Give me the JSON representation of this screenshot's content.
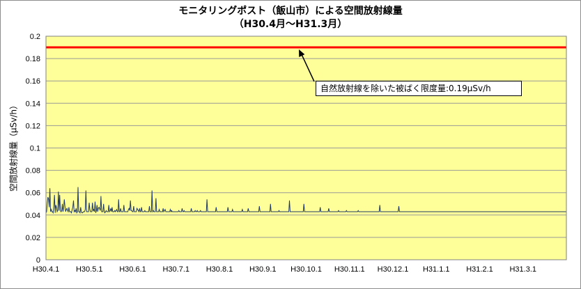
{
  "chart_data": {
    "type": "line",
    "title": "モニタリングポスト（飯山市）による空間放射線量",
    "subtitle": "（H30.4月～H31.3月）",
    "ylabel": "空間放射線量（μSv/h）",
    "xlabel": "",
    "ylim": [
      0,
      0.2
    ],
    "y_ticks": [
      "0",
      "0.02",
      "0.04",
      "0.06",
      "0.08",
      "0.1",
      "0.12",
      "0.14",
      "0.16",
      "0.18",
      "0.2"
    ],
    "x_ticks": [
      "H30.4.1",
      "H30.5.1",
      "H30.6.1",
      "H30.7.1",
      "H30.8.1",
      "H30.9.1",
      "H30.10.1",
      "H30.11.1",
      "H30.12.1",
      "H31.1.1",
      "H31.2.1",
      "H31.3.1"
    ],
    "grid": true,
    "reference_line": {
      "value": 0.19,
      "label": "自然放射線を除いた被ばく限度量:0.19μSv/h",
      "color": "#ff0000"
    },
    "series_color": "#1f3864",
    "plot_background": "#ffff99",
    "series": [
      {
        "values": [
          0.042,
          0.043,
          0.051,
          0.056,
          0.054,
          0.047,
          0.064,
          0.043,
          0.045,
          0.043,
          0.043,
          0.042,
          0.048,
          0.058,
          0.042,
          0.049,
          0.047,
          0.043,
          0.044,
          0.061,
          0.044,
          0.058,
          0.044,
          0.043,
          0.044,
          0.05,
          0.043,
          0.047,
          0.054,
          0.048,
          0.043,
          0.045,
          0.046,
          0.044,
          0.043,
          0.047,
          0.043,
          0.043,
          0.043,
          0.042,
          0.045,
          0.047,
          0.053,
          0.043,
          0.044,
          0.043,
          0.046,
          0.042,
          0.043,
          0.065,
          0.043,
          0.043,
          0.042,
          0.047,
          0.043,
          0.042,
          0.042,
          0.043,
          0.043,
          0.043,
          0.045,
          0.062,
          0.043,
          0.043,
          0.043,
          0.043,
          0.051,
          0.045,
          0.043,
          0.043,
          0.043,
          0.051,
          0.044,
          0.045,
          0.043,
          0.052,
          0.042,
          0.044,
          0.049,
          0.043,
          0.046,
          0.047,
          0.046,
          0.044,
          0.057,
          0.043,
          0.043,
          0.043,
          0.05,
          0.043,
          0.042,
          0.043,
          0.044,
          0.043,
          0.043,
          0.043,
          0.049,
          0.043,
          0.044,
          0.046,
          0.043,
          0.047,
          0.043,
          0.043,
          0.043,
          0.044,
          0.043,
          0.044,
          0.045,
          0.043,
          0.043,
          0.054,
          0.043,
          0.043,
          0.046,
          0.043,
          0.043,
          0.043,
          0.043,
          0.049,
          0.043,
          0.043,
          0.043,
          0.043,
          0.043,
          0.043,
          0.045,
          0.046,
          0.044,
          0.053,
          0.044,
          0.044,
          0.043,
          0.043,
          0.048,
          0.043,
          0.043,
          0.043,
          0.043,
          0.046,
          0.045,
          0.044,
          0.043,
          0.046,
          0.043,
          0.043,
          0.047,
          0.043,
          0.043,
          0.043,
          0.043,
          0.044,
          0.043,
          0.043,
          0.043,
          0.043,
          0.043,
          0.043,
          0.048,
          0.043,
          0.043,
          0.043,
          0.062,
          0.043,
          0.044,
          0.043,
          0.043,
          0.043,
          0.055,
          0.043,
          0.043,
          0.043,
          0.043,
          0.045,
          0.043,
          0.043,
          0.043,
          0.043,
          0.043,
          0.046,
          0.043,
          0.044,
          0.045,
          0.043,
          0.043,
          0.043,
          0.043,
          0.043,
          0.043,
          0.043,
          0.045,
          0.043,
          0.044,
          0.043,
          0.043,
          0.043,
          0.043,
          0.043,
          0.043,
          0.043,
          0.043,
          0.043,
          0.043,
          0.044,
          0.043,
          0.043,
          0.043,
          0.043,
          0.046,
          0.043,
          0.043,
          0.044,
          0.043,
          0.043,
          0.043,
          0.043,
          0.043,
          0.043,
          0.043,
          0.043,
          0.043,
          0.043,
          0.046,
          0.043,
          0.043,
          0.043,
          0.043,
          0.043,
          0.044,
          0.043,
          0.043,
          0.044,
          0.043,
          0.043,
          0.043,
          0.043,
          0.044,
          0.043,
          0.043,
          0.043,
          0.043,
          0.043,
          0.043,
          0.043,
          0.043,
          0.043,
          0.054,
          0.043,
          0.043,
          0.043,
          0.043,
          0.043,
          0.043,
          0.043,
          0.043,
          0.043,
          0.043,
          0.043,
          0.043,
          0.043,
          0.047,
          0.043,
          0.043,
          0.043,
          0.043,
          0.043,
          0.043,
          0.043,
          0.043,
          0.043,
          0.043,
          0.043,
          0.043,
          0.043,
          0.043,
          0.043,
          0.043,
          0.043,
          0.047,
          0.043,
          0.043,
          0.043,
          0.043,
          0.043,
          0.043,
          0.045,
          0.043,
          0.043,
          0.043,
          0.043,
          0.043,
          0.043,
          0.043,
          0.043,
          0.043,
          0.043,
          0.043,
          0.043,
          0.043,
          0.043,
          0.045,
          0.043,
          0.043,
          0.043,
          0.043,
          0.043,
          0.043,
          0.043,
          0.043,
          0.046,
          0.043,
          0.043,
          0.043,
          0.043,
          0.043,
          0.043,
          0.043,
          0.043,
          0.043,
          0.043,
          0.043,
          0.043,
          0.043,
          0.043,
          0.043,
          0.043,
          0.048,
          0.043,
          0.043,
          0.043,
          0.043,
          0.043,
          0.043,
          0.043,
          0.043,
          0.043,
          0.043,
          0.043,
          0.043,
          0.043,
          0.043,
          0.043,
          0.043,
          0.05,
          0.043,
          0.043,
          0.043,
          0.043,
          0.043,
          0.043,
          0.043,
          0.043,
          0.043,
          0.043,
          0.043,
          0.043,
          0.044,
          0.043,
          0.043,
          0.043,
          0.043,
          0.043,
          0.043,
          0.043,
          0.043,
          0.043,
          0.043,
          0.043,
          0.043,
          0.043,
          0.043,
          0.043,
          0.053,
          0.043,
          0.043,
          0.043,
          0.043,
          0.043,
          0.043,
          0.043,
          0.043,
          0.043,
          0.043,
          0.043,
          0.043,
          0.043,
          0.043,
          0.043,
          0.043,
          0.043,
          0.043,
          0.043,
          0.043,
          0.043,
          0.05,
          0.043,
          0.043,
          0.043,
          0.043,
          0.043,
          0.043,
          0.043,
          0.043,
          0.043,
          0.043,
          0.043,
          0.043,
          0.043,
          0.043,
          0.043,
          0.043,
          0.043,
          0.043,
          0.043,
          0.043,
          0.043,
          0.043,
          0.043,
          0.043,
          0.047,
          0.043,
          0.043,
          0.043,
          0.043,
          0.043,
          0.043,
          0.043,
          0.043,
          0.043,
          0.043,
          0.043,
          0.043,
          0.046,
          0.043,
          0.043,
          0.043,
          0.043,
          0.043,
          0.043,
          0.043,
          0.043,
          0.043,
          0.043,
          0.043,
          0.043,
          0.043,
          0.043,
          0.044,
          0.043,
          0.043,
          0.043,
          0.043,
          0.043,
          0.043,
          0.043,
          0.043,
          0.043,
          0.043,
          0.043,
          0.044,
          0.043,
          0.043,
          0.043,
          0.043,
          0.043,
          0.043,
          0.043,
          0.043,
          0.043,
          0.043,
          0.043,
          0.043,
          0.043,
          0.043,
          0.043,
          0.043,
          0.043,
          0.044,
          0.043,
          0.043,
          0.043,
          0.043,
          0.043,
          0.043,
          0.043,
          0.043,
          0.043,
          0.043,
          0.043,
          0.043,
          0.043,
          0.043,
          0.043,
          0.043,
          0.043,
          0.043,
          0.043,
          0.043,
          0.043,
          0.043,
          0.043,
          0.043,
          0.043,
          0.043,
          0.043,
          0.043,
          0.043,
          0.043,
          0.043,
          0.043,
          0.049,
          0.043,
          0.043,
          0.043,
          0.043,
          0.043,
          0.043,
          0.043,
          0.043,
          0.043,
          0.043,
          0.043,
          0.043,
          0.043,
          0.043,
          0.043,
          0.043,
          0.043,
          0.043,
          0.043,
          0.043,
          0.043,
          0.043,
          0.043,
          0.043,
          0.043,
          0.043,
          0.043,
          0.043,
          0.048,
          0.043,
          0.043,
          0.043,
          0.043,
          0.043,
          0.043,
          0.043,
          0.043,
          0.043,
          0.043,
          0.043,
          0.043,
          0.043,
          0.043,
          0.043,
          0.043,
          0.043,
          0.043,
          0.043,
          0.043,
          0.043,
          0.043,
          0.043,
          0.043,
          0.043,
          0.043,
          0.043,
          0.043,
          0.043,
          0.043,
          0.043,
          0.043,
          0.043,
          0.043,
          0.043,
          0.043,
          0.043,
          0.043,
          0.043,
          0.043,
          0.043,
          0.043,
          0.043,
          0.043,
          0.043,
          0.043,
          0.043,
          0.043,
          0.043,
          0.043,
          0.043,
          0.043,
          0.043,
          0.043,
          0.043,
          0.043,
          0.043,
          0.043,
          0.043,
          0.043,
          0.043,
          0.043,
          0.043,
          0.043,
          0.043,
          0.043,
          0.043,
          0.043,
          0.043,
          0.043,
          0.043,
          0.043,
          0.043,
          0.043,
          0.043,
          0.043,
          0.043,
          0.043,
          0.043,
          0.043,
          0.043,
          0.043,
          0.043,
          0.043,
          0.043,
          0.043,
          0.043,
          0.043,
          0.043,
          0.043,
          0.043,
          0.043,
          0.043,
          0.043,
          0.043,
          0.043,
          0.043,
          0.043,
          0.043,
          0.043,
          0.043,
          0.043,
          0.043,
          0.043,
          0.043,
          0.043,
          0.043,
          0.043,
          0.043,
          0.043,
          0.043,
          0.043,
          0.043,
          0.043,
          0.043,
          0.043,
          0.043,
          0.043,
          0.043,
          0.043,
          0.043,
          0.043,
          0.043,
          0.043,
          0.043,
          0.043,
          0.043,
          0.043,
          0.043,
          0.043,
          0.043,
          0.043,
          0.043,
          0.043,
          0.043,
          0.043,
          0.043,
          0.043,
          0.043,
          0.043,
          0.043,
          0.043,
          0.043,
          0.043,
          0.043,
          0.043,
          0.043,
          0.043,
          0.043,
          0.043,
          0.043,
          0.043,
          0.043,
          0.043,
          0.043,
          0.043,
          0.043,
          0.043,
          0.043,
          0.043,
          0.043,
          0.043,
          0.043,
          0.043,
          0.043,
          0.043,
          0.043,
          0.043,
          0.043,
          0.043,
          0.043,
          0.043,
          0.043,
          0.043,
          0.043,
          0.043,
          0.043,
          0.043,
          0.043,
          0.043,
          0.043,
          0.043,
          0.043,
          0.043,
          0.043,
          0.043,
          0.043,
          0.043,
          0.043,
          0.043,
          0.043,
          0.043,
          0.043,
          0.043,
          0.043,
          0.043,
          0.043,
          0.043,
          0.043,
          0.043,
          0.043,
          0.043,
          0.043,
          0.043,
          0.043,
          0.043,
          0.043,
          0.043,
          0.043,
          0.043,
          0.043,
          0.043,
          0.043,
          0.043,
          0.043,
          0.043,
          0.043,
          0.043,
          0.043,
          0.043,
          0.043,
          0.043,
          0.043,
          0.043,
          0.043,
          0.043,
          0.043,
          0.043,
          0.043,
          0.043,
          0.043,
          0.043,
          0.043,
          0.043,
          0.043,
          0.043,
          0.043,
          0.043,
          0.043,
          0.043,
          0.043,
          0.043,
          0.043,
          0.043,
          0.043,
          0.043,
          0.043,
          0.043,
          0.043,
          0.043,
          0.043,
          0.043,
          0.043,
          0.043,
          0.043,
          0.043
        ]
      }
    ]
  }
}
